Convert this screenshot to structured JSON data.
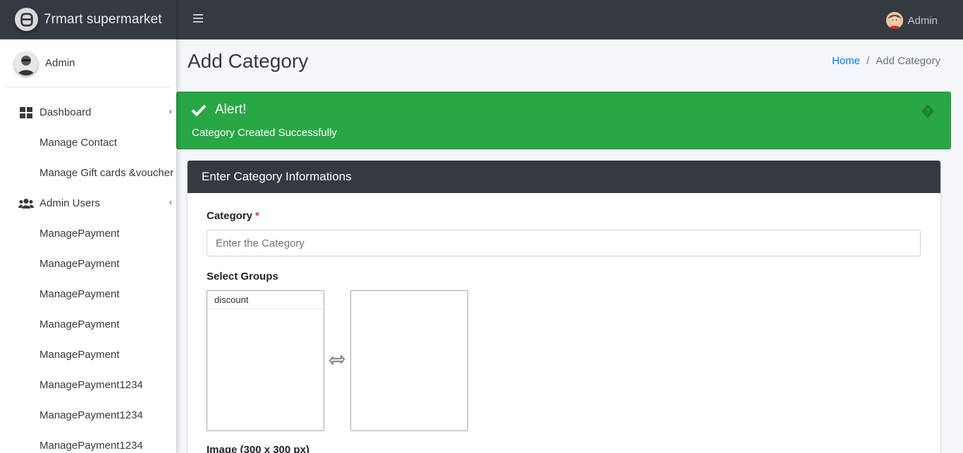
{
  "brand": {
    "name": "7rmart supermarket"
  },
  "user": {
    "name": "Admin"
  },
  "sidebar": {
    "items": [
      {
        "label": "Dashboard",
        "icon": "th-large-icon",
        "sub": false,
        "arrow": true
      },
      {
        "label": "Manage Contact",
        "sub": true
      },
      {
        "label": "Manage Gift cards &voucher",
        "sub": true
      },
      {
        "label": "Admin Users",
        "icon": "users-icon",
        "sub": false,
        "arrow": true
      },
      {
        "label": "ManagePayment",
        "sub": true
      },
      {
        "label": "ManagePayment",
        "sub": true
      },
      {
        "label": "ManagePayment",
        "sub": true
      },
      {
        "label": "ManagePayment",
        "sub": true
      },
      {
        "label": "ManagePayment",
        "sub": true
      },
      {
        "label": "ManagePayment1234",
        "sub": true
      },
      {
        "label": "ManagePayment1234",
        "sub": true
      },
      {
        "label": "ManagePayment1234",
        "sub": true
      }
    ],
    "arrow_glyph": "‹"
  },
  "topbar": {
    "user_name": "Admin"
  },
  "page": {
    "title": "Add Category",
    "breadcrumb": {
      "home": "Home",
      "separator": "/",
      "current": "Add Category"
    }
  },
  "alert": {
    "title": "Alert!",
    "message": "Category Created Successfully",
    "close_glyph": "�"
  },
  "card": {
    "header": "Enter Category Informations",
    "category_label": "Category",
    "required_mark": "*",
    "category_placeholder": "Enter the Category",
    "groups_label": "Select Groups",
    "groups_available": [
      "discount"
    ],
    "groups_selected": [],
    "image_label": "Image (300 x 300 px)"
  },
  "colors": {
    "sidebar_bg": "#ffffff",
    "topbar_bg": "#343a40",
    "success": "#28a745",
    "link": "#007bff",
    "required": "#dc3545"
  }
}
